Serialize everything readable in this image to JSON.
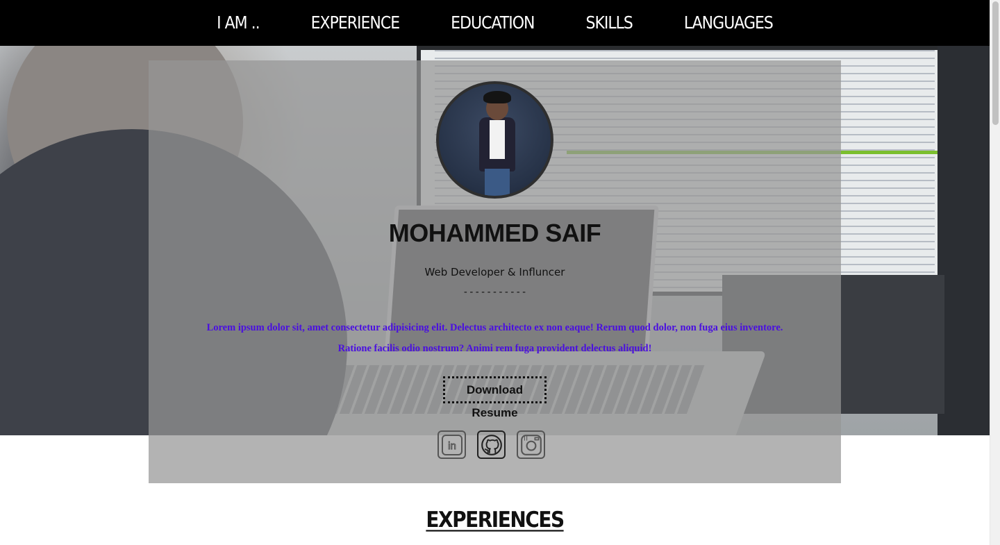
{
  "nav": {
    "items": [
      {
        "label": "I AM .."
      },
      {
        "label": "EXPERIENCE"
      },
      {
        "label": "EDUCATION"
      },
      {
        "label": "SKILLS"
      },
      {
        "label": "LANGUAGES"
      }
    ]
  },
  "profile": {
    "name": "MOHAMMED SAIF",
    "role": "Web Developer & Influncer",
    "divider": "-----------",
    "bio": "Lorem ipsum dolor sit, amet consectetur adipisicing elit. Delectus architecto ex non eaque! Rerum quod dolor, non fuga eius inventore. Ratione facilis odio nostrum? Animi rem fuga provident delectus aliquid!",
    "download_label": "Download Resume",
    "socials": [
      {
        "icon": "linkedin-icon"
      },
      {
        "icon": "github-icon"
      },
      {
        "icon": "instagram-icon"
      }
    ]
  },
  "sections": {
    "experiences_heading": "EXPERIENCES"
  },
  "colors": {
    "nav_bg": "#000000",
    "bio_text": "#4a0fe0",
    "card_overlay": "#969696"
  }
}
